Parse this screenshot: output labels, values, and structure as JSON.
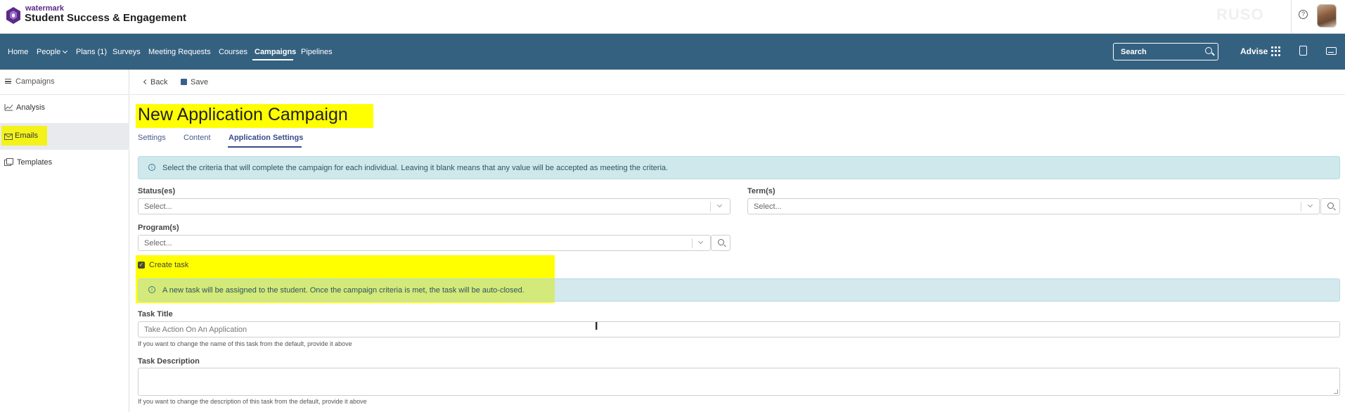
{
  "header": {
    "brand_small": "watermark",
    "brand_title": "Student Success & Engagement",
    "ghost_logo": "RUSO",
    "help_symbol": "?"
  },
  "nav": {
    "items": [
      {
        "label": "Home"
      },
      {
        "label": "People"
      },
      {
        "label": "Plans (1)"
      },
      {
        "label": "Surveys"
      },
      {
        "label": "Meeting Requests"
      },
      {
        "label": "Courses"
      },
      {
        "label": "Campaigns"
      },
      {
        "label": "Pipelines"
      }
    ],
    "active": "Campaigns",
    "search_label": "Search",
    "advise_label": "Advise"
  },
  "sidebar": {
    "heading": "Campaigns",
    "items": [
      {
        "label": "Analysis",
        "icon": "chart-icon"
      },
      {
        "label": "Emails",
        "icon": "envelope-icon"
      },
      {
        "label": "Templates",
        "icon": "templates-icon"
      }
    ],
    "selected": "Emails"
  },
  "toolbar": {
    "back_label": "Back",
    "save_label": "Save"
  },
  "main": {
    "title": "New Application Campaign",
    "tabs": [
      {
        "label": "Settings"
      },
      {
        "label": "Content"
      },
      {
        "label": "Application Settings"
      }
    ],
    "active_tab": "Application Settings",
    "criteria_info": "Select the criteria that will complete the campaign for each individual. Leaving it blank means that any value will be accepted as meeting the criteria.",
    "status": {
      "label": "Status(es)",
      "placeholder": "Select..."
    },
    "term": {
      "label": "Term(s)",
      "placeholder": "Select..."
    },
    "program": {
      "label": "Program(s)",
      "placeholder": "Select..."
    },
    "create_task": {
      "label": "Create task",
      "checked": true
    },
    "task_info": "A new task will be assigned to the student. Once the campaign criteria is met, the task will be auto-closed.",
    "task_title": {
      "label": "Task Title",
      "value": "Take Action On An Application",
      "help": "If you want to change the name of this task from the default, provide it above"
    },
    "task_description": {
      "label": "Task Description",
      "value": "",
      "help": "If you want to change the description of this task from the default, provide it above"
    }
  },
  "colors": {
    "navbar": "#356181",
    "highlight": "#ffff00",
    "info_bg": "#cfe8ec",
    "brand_purple": "#5b2a86"
  }
}
